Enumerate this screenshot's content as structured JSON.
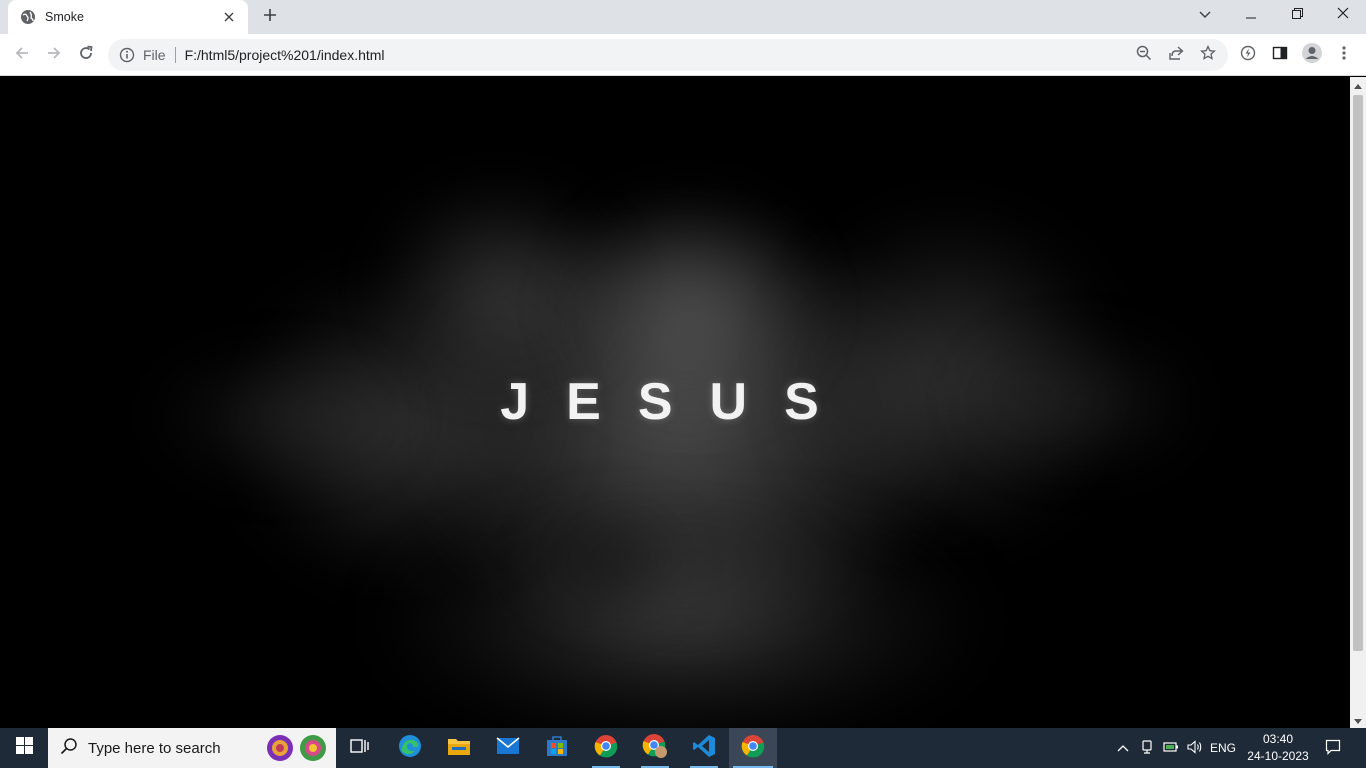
{
  "browser": {
    "tab_title": "Smoke",
    "omnibox": {
      "scheme_label": "File",
      "url": "F:/html5/project%201/index.html"
    },
    "icons": {
      "favicon": "globe-icon",
      "tab_close": "close-icon",
      "new_tab": "plus-icon",
      "back": "arrow-left-icon",
      "forward": "arrow-right-icon",
      "reload": "reload-icon",
      "site_info": "info-icon",
      "zoom": "zoom-out-icon",
      "share": "share-icon",
      "bookmark": "star-icon",
      "performance": "lightning-icon",
      "side_panel": "side-panel-icon",
      "profile": "person-icon",
      "menu": "kebab-menu-icon"
    },
    "window_controls": [
      "chevron-down-icon",
      "minimize-icon",
      "restore-icon",
      "close-icon"
    ]
  },
  "page": {
    "title_text": "JESUS",
    "background": "#000000",
    "smoke_color": "#8a8a8a"
  },
  "taskbar": {
    "search_placeholder": "Type here to search",
    "apps": [
      "task-view",
      "edge",
      "file-explorer",
      "mail",
      "microsoft-store",
      "chrome",
      "chrome-profile",
      "vscode",
      "chrome-active"
    ],
    "tray": {
      "language": "ENG",
      "time": "03:40",
      "date": "24-10-2023"
    },
    "accent": "#76b9ed"
  }
}
